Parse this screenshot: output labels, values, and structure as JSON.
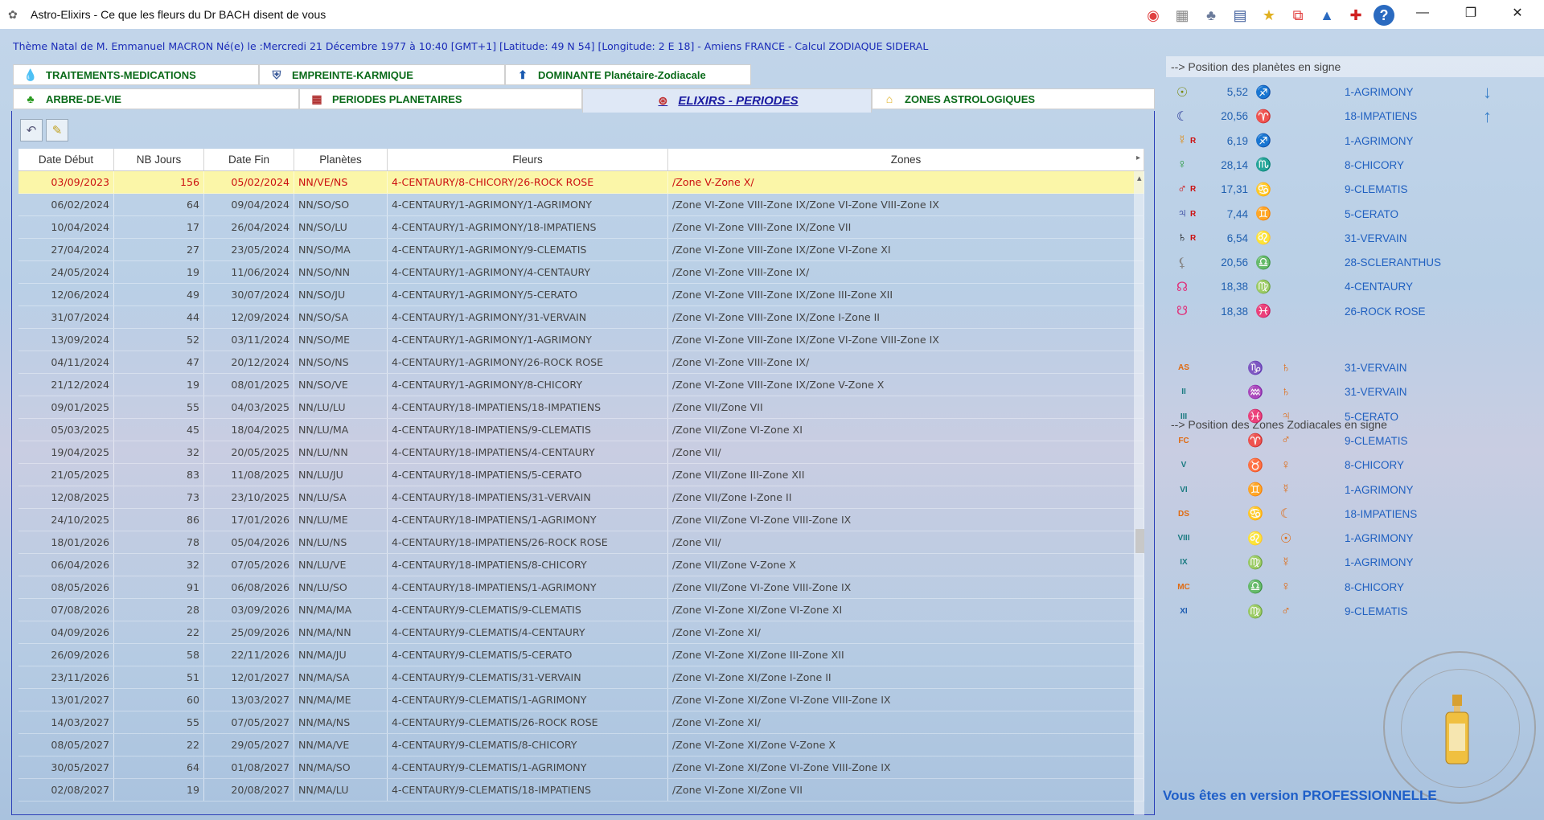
{
  "window": {
    "title": "Astro-Elixirs - Ce que les fleurs du Dr BACH disent de vous",
    "toolbar_icons": [
      "color-wheel-icon",
      "grid-icon",
      "figures-icon",
      "scroll-icon",
      "folder-star-icon",
      "copy-icon",
      "image-icon",
      "pin-icon",
      "help-icon"
    ],
    "help_glyph": "?"
  },
  "theme_line": "Thème Natal de M. Emmanuel   MACRON Né(e) le :Mercredi 21 Décembre 1977 à 10:40 [GMT+1] [Latitude: 49 N 54] [Longitude: 2 E 18] - Amiens FRANCE - Calcul ZODIAQUE SIDERAL",
  "tabs_row1": [
    {
      "label": "TRAITEMENTS-MEDICATIONS",
      "icon": "drop-icon"
    },
    {
      "label": "EMPREINTE-KARMIQUE",
      "icon": "shield-icon"
    },
    {
      "label": "DOMINANTE Planétaire-Zodiacale",
      "icon": "up-circle-icon"
    }
  ],
  "tabs_row2": [
    {
      "label": "ARBRE-DE-VIE",
      "icon": "tree-icon"
    },
    {
      "label": "PERIODES PLANETAIRES",
      "icon": "calendar-icon"
    },
    {
      "label": "ELIXIRS - PERIODES",
      "icon": "elixir-icon",
      "active": true
    },
    {
      "label": "ZONES ASTROLOGIQUES",
      "icon": "house-icon"
    }
  ],
  "table": {
    "columns": [
      "Date Début",
      "NB Jours",
      "Date Fin",
      "Planètes",
      "Fleurs",
      "Zones"
    ],
    "rows": [
      [
        "03/09/2023",
        "156",
        "05/02/2024",
        "NN/VE/NS",
        "4-CENTAURY/8-CHICORY/26-ROCK ROSE",
        "/Zone V-Zone X/"
      ],
      [
        "06/02/2024",
        "64",
        "09/04/2024",
        "NN/SO/SO",
        "4-CENTAURY/1-AGRIMONY/1-AGRIMONY",
        "/Zone VI-Zone VIII-Zone IX/Zone VI-Zone VIII-Zone IX"
      ],
      [
        "10/04/2024",
        "17",
        "26/04/2024",
        "NN/SO/LU",
        "4-CENTAURY/1-AGRIMONY/18-IMPATIENS",
        "/Zone VI-Zone VIII-Zone IX/Zone VII"
      ],
      [
        "27/04/2024",
        "27",
        "23/05/2024",
        "NN/SO/MA",
        "4-CENTAURY/1-AGRIMONY/9-CLEMATIS",
        "/Zone VI-Zone VIII-Zone IX/Zone VI-Zone XI"
      ],
      [
        "24/05/2024",
        "19",
        "11/06/2024",
        "NN/SO/NN",
        "4-CENTAURY/1-AGRIMONY/4-CENTAURY",
        "/Zone VI-Zone VIII-Zone IX/"
      ],
      [
        "12/06/2024",
        "49",
        "30/07/2024",
        "NN/SO/JU",
        "4-CENTAURY/1-AGRIMONY/5-CERATO",
        "/Zone VI-Zone VIII-Zone IX/Zone III-Zone XII"
      ],
      [
        "31/07/2024",
        "44",
        "12/09/2024",
        "NN/SO/SA",
        "4-CENTAURY/1-AGRIMONY/31-VERVAIN",
        "/Zone VI-Zone VIII-Zone IX/Zone I-Zone II"
      ],
      [
        "13/09/2024",
        "52",
        "03/11/2024",
        "NN/SO/ME",
        "4-CENTAURY/1-AGRIMONY/1-AGRIMONY",
        "/Zone VI-Zone VIII-Zone IX/Zone VI-Zone VIII-Zone IX"
      ],
      [
        "04/11/2024",
        "47",
        "20/12/2024",
        "NN/SO/NS",
        "4-CENTAURY/1-AGRIMONY/26-ROCK ROSE",
        "/Zone VI-Zone VIII-Zone IX/"
      ],
      [
        "21/12/2024",
        "19",
        "08/01/2025",
        "NN/SO/VE",
        "4-CENTAURY/1-AGRIMONY/8-CHICORY",
        "/Zone VI-Zone VIII-Zone IX/Zone V-Zone X"
      ],
      [
        "09/01/2025",
        "55",
        "04/03/2025",
        "NN/LU/LU",
        "4-CENTAURY/18-IMPATIENS/18-IMPATIENS",
        "/Zone VII/Zone VII"
      ],
      [
        "05/03/2025",
        "45",
        "18/04/2025",
        "NN/LU/MA",
        "4-CENTAURY/18-IMPATIENS/9-CLEMATIS",
        "/Zone VII/Zone VI-Zone XI"
      ],
      [
        "19/04/2025",
        "32",
        "20/05/2025",
        "NN/LU/NN",
        "4-CENTAURY/18-IMPATIENS/4-CENTAURY",
        "/Zone VII/"
      ],
      [
        "21/05/2025",
        "83",
        "11/08/2025",
        "NN/LU/JU",
        "4-CENTAURY/18-IMPATIENS/5-CERATO",
        "/Zone VII/Zone III-Zone XII"
      ],
      [
        "12/08/2025",
        "73",
        "23/10/2025",
        "NN/LU/SA",
        "4-CENTAURY/18-IMPATIENS/31-VERVAIN",
        "/Zone VII/Zone I-Zone II"
      ],
      [
        "24/10/2025",
        "86",
        "17/01/2026",
        "NN/LU/ME",
        "4-CENTAURY/18-IMPATIENS/1-AGRIMONY",
        "/Zone VII/Zone VI-Zone VIII-Zone IX"
      ],
      [
        "18/01/2026",
        "78",
        "05/04/2026",
        "NN/LU/NS",
        "4-CENTAURY/18-IMPATIENS/26-ROCK ROSE",
        "/Zone VII/"
      ],
      [
        "06/04/2026",
        "32",
        "07/05/2026",
        "NN/LU/VE",
        "4-CENTAURY/18-IMPATIENS/8-CHICORY",
        "/Zone VII/Zone V-Zone X"
      ],
      [
        "08/05/2026",
        "91",
        "06/08/2026",
        "NN/LU/SO",
        "4-CENTAURY/18-IMPATIENS/1-AGRIMONY",
        "/Zone VII/Zone VI-Zone VIII-Zone IX"
      ],
      [
        "07/08/2026",
        "28",
        "03/09/2026",
        "NN/MA/MA",
        "4-CENTAURY/9-CLEMATIS/9-CLEMATIS",
        "/Zone VI-Zone XI/Zone VI-Zone XI"
      ],
      [
        "04/09/2026",
        "22",
        "25/09/2026",
        "NN/MA/NN",
        "4-CENTAURY/9-CLEMATIS/4-CENTAURY",
        "/Zone VI-Zone XI/"
      ],
      [
        "26/09/2026",
        "58",
        "22/11/2026",
        "NN/MA/JU",
        "4-CENTAURY/9-CLEMATIS/5-CERATO",
        "/Zone VI-Zone XI/Zone III-Zone XII"
      ],
      [
        "23/11/2026",
        "51",
        "12/01/2027",
        "NN/MA/SA",
        "4-CENTAURY/9-CLEMATIS/31-VERVAIN",
        "/Zone VI-Zone XI/Zone I-Zone II"
      ],
      [
        "13/01/2027",
        "60",
        "13/03/2027",
        "NN/MA/ME",
        "4-CENTAURY/9-CLEMATIS/1-AGRIMONY",
        "/Zone VI-Zone XI/Zone VI-Zone VIII-Zone IX"
      ],
      [
        "14/03/2027",
        "55",
        "07/05/2027",
        "NN/MA/NS",
        "4-CENTAURY/9-CLEMATIS/26-ROCK ROSE",
        "/Zone VI-Zone XI/"
      ],
      [
        "08/05/2027",
        "22",
        "29/05/2027",
        "NN/MA/VE",
        "4-CENTAURY/9-CLEMATIS/8-CHICORY",
        "/Zone VI-Zone XI/Zone V-Zone X"
      ],
      [
        "30/05/2027",
        "64",
        "01/08/2027",
        "NN/MA/SO",
        "4-CENTAURY/9-CLEMATIS/1-AGRIMONY",
        "/Zone VI-Zone XI/Zone VI-Zone VIII-Zone IX"
      ],
      [
        "02/08/2027",
        "19",
        "20/08/2027",
        "NN/MA/LU",
        "4-CENTAURY/9-CLEMATIS/18-IMPATIENS",
        "/Zone VI-Zone XI/Zone VII"
      ]
    ]
  },
  "planets_title": "--> Position des planètes en signe",
  "planets": [
    {
      "symbol": "☉",
      "color": "#7a8a10",
      "retro": "",
      "deg": "5,52",
      "sign": "♐",
      "sign_color": "#7a8a10",
      "flower": "1-AGRIMONY",
      "arrow": "↓"
    },
    {
      "symbol": "☾",
      "color": "#1a2a90",
      "retro": "",
      "deg": "20,56",
      "sign": "♈",
      "sign_color": "#1a2a90",
      "flower": "18-IMPATIENS",
      "arrow": "↑"
    },
    {
      "symbol": "☿",
      "color": "#e08a10",
      "retro": "R",
      "deg": "6,19",
      "sign": "♐",
      "sign_color": "#e08a10",
      "flower": "1-AGRIMONY",
      "arrow": ""
    },
    {
      "symbol": "♀",
      "color": "#2a9a40",
      "retro": "",
      "deg": "28,14",
      "sign": "♏",
      "sign_color": "#2a9a40",
      "flower": "8-CHICORY",
      "arrow": ""
    },
    {
      "symbol": "♂",
      "color": "#d01010",
      "retro": "R",
      "deg": "17,31",
      "sign": "♋",
      "sign_color": "#d01010",
      "flower": "9-CLEMATIS",
      "arrow": ""
    },
    {
      "symbol": "♃",
      "color": "#1a2a90",
      "retro": "R",
      "deg": "7,44",
      "sign": "♊",
      "sign_color": "#1a2a90",
      "flower": "5-CERATO",
      "arrow": ""
    },
    {
      "symbol": "♄",
      "color": "#111111",
      "retro": "R",
      "deg": "6,54",
      "sign": "♌",
      "sign_color": "#111111",
      "flower": "31-VERVAIN",
      "arrow": ""
    },
    {
      "symbol": "⚸",
      "color": "#888888",
      "retro": "",
      "deg": "20,56",
      "sign": "♎",
      "sign_color": "#888888",
      "flower": "28-SCLERANTHUS",
      "arrow": ""
    },
    {
      "symbol": "☊",
      "color": "#e0307a",
      "retro": "",
      "deg": "18,38",
      "sign": "♍",
      "sign_color": "#e0307a",
      "flower": "4-CENTAURY",
      "arrow": ""
    },
    {
      "symbol": "☋",
      "color": "#e0307a",
      "retro": "",
      "deg": "18,38",
      "sign": "♓",
      "sign_color": "#e0307a",
      "flower": "26-ROCK ROSE",
      "arrow": ""
    }
  ],
  "zones_title": "--> Position des Zones Zodiacales en signe",
  "zones": [
    {
      "label": "AS",
      "label_color": "orange",
      "sign": "♑",
      "planet": "♄",
      "flower": "31-VERVAIN"
    },
    {
      "label": "II",
      "label_color": "teal",
      "sign": "♒",
      "planet": "♄",
      "flower": "31-VERVAIN"
    },
    {
      "label": "III",
      "label_color": "teal",
      "sign": "♓",
      "planet": "♃",
      "flower": "5-CERATO"
    },
    {
      "label": "FC",
      "label_color": "orange",
      "sign": "♈",
      "planet": "♂",
      "flower": "9-CLEMATIS"
    },
    {
      "label": "V",
      "label_color": "teal",
      "sign": "♉",
      "planet": "♀",
      "flower": "8-CHICORY"
    },
    {
      "label": "VI",
      "label_color": "teal",
      "sign": "♊",
      "planet": "☿",
      "flower": "1-AGRIMONY"
    },
    {
      "label": "DS",
      "label_color": "orange",
      "sign": "♋",
      "planet": "☾",
      "flower": "18-IMPATIENS"
    },
    {
      "label": "VIII",
      "label_color": "teal",
      "sign": "♌",
      "planet": "☉",
      "flower": "1-AGRIMONY"
    },
    {
      "label": "IX",
      "label_color": "teal",
      "sign": "♍",
      "planet": "☿",
      "flower": "1-AGRIMONY"
    },
    {
      "label": "MC",
      "label_color": "orange",
      "sign": "♎",
      "planet": "♀",
      "flower": "8-CHICORY"
    },
    {
      "label": "XI",
      "label_color": "blue",
      "sign": "♍",
      "planet": "♂",
      "flower": "9-CLEMATIS"
    }
  ],
  "pro_text": "Vous êtes en version PROFESSIONNELLE"
}
